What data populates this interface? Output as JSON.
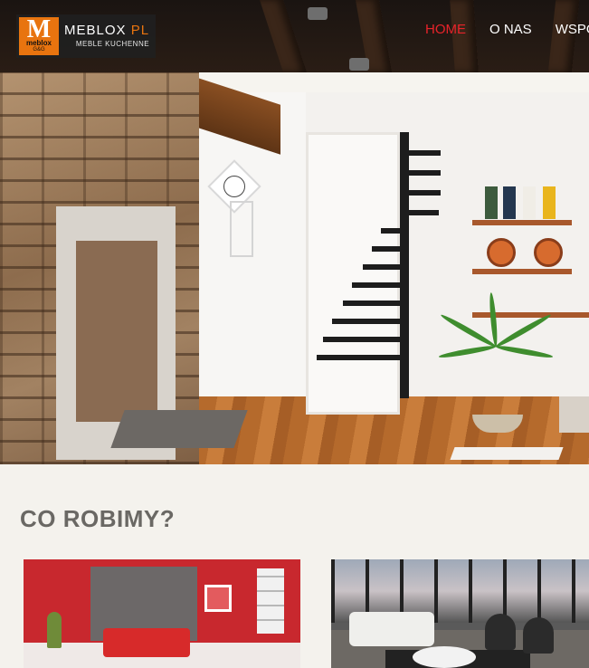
{
  "header": {
    "logo": {
      "letter": "M",
      "small_text": "meblox",
      "small_text2": "G&G",
      "brand_main": "MEBLOX",
      "brand_accent": "PL",
      "tagline": "MEBLE KUCHENNE"
    },
    "nav": [
      {
        "label": "HOME",
        "active": true
      },
      {
        "label": "O NAS",
        "active": false
      },
      {
        "label": "WSPÓŁPRACA",
        "active": false
      }
    ]
  },
  "hero": {
    "image": "living-room-with-stone-fireplace-and-staircase"
  },
  "section": {
    "title": "CO ROBIMY?"
  },
  "cards": [
    {
      "image": "red-room-with-sofa"
    },
    {
      "image": "modern-living-room-with-windows"
    }
  ],
  "colors": {
    "accent": "#e8740f",
    "nav_active": "#e8232a",
    "header_bg": "#1a1411",
    "page_bg": "#f4f2ed",
    "title_text": "#6a6864"
  }
}
